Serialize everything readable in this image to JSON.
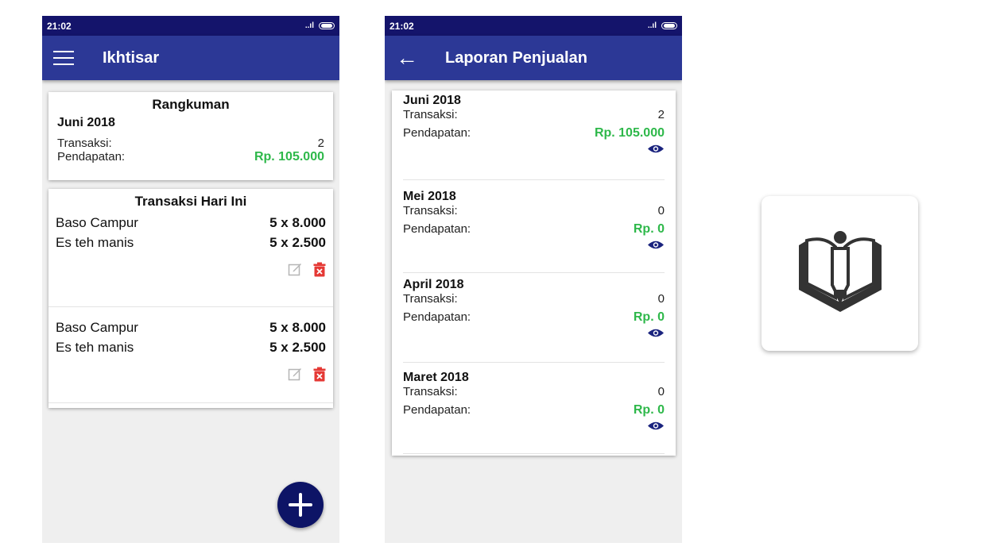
{
  "colors": {
    "statusbar": "#14146b",
    "appbar": "#2c3896",
    "fab": "#0d1466",
    "income_green": "#2eb84a",
    "delete_red": "#e53935",
    "eye_blue": "#1a237e"
  },
  "screen1": {
    "status_time": "21:02",
    "title": "Ikhtisar",
    "summary": {
      "title": "Rangkuman",
      "month": "Juni 2018",
      "transactions_label": "Transaksi:",
      "transactions_value": "2",
      "income_label": "Pendapatan:",
      "income_value": "Rp. 105.000"
    },
    "today": {
      "title": "Transaksi Hari Ini",
      "transactions": [
        {
          "items": [
            {
              "name": "Baso Campur",
              "qty": "5 x 8.000"
            },
            {
              "name": "Es teh manis",
              "qty": "5 x 2.500"
            }
          ]
        },
        {
          "items": [
            {
              "name": "Baso Campur",
              "qty": "5 x 8.000"
            },
            {
              "name": "Es teh manis",
              "qty": "5 x 2.500"
            }
          ]
        }
      ]
    }
  },
  "screen2": {
    "status_time": "21:02",
    "title": "Laporan Penjualan",
    "reports": [
      {
        "month": "Juni 2018",
        "transactions_label": "Transaksi:",
        "transactions_value": "2",
        "income_label": "Pendapatan:",
        "income_value": "Rp. 105.000"
      },
      {
        "month": "Mei 2018",
        "transactions_label": "Transaksi:",
        "transactions_value": "0",
        "income_label": "Pendapatan:",
        "income_value": "Rp. 0"
      },
      {
        "month": "April 2018",
        "transactions_label": "Transaksi:",
        "transactions_value": "0",
        "income_label": "Pendapatan:",
        "income_value": "Rp. 0"
      },
      {
        "month": "Maret 2018",
        "transactions_label": "Transaksi:",
        "transactions_value": "0",
        "income_label": "Pendapatan:",
        "income_value": "Rp. 0"
      }
    ]
  },
  "icons": {
    "menu": "hamburger-icon",
    "back": "arrow-left-icon",
    "edit": "edit-icon",
    "delete": "trash-icon",
    "view": "eye-icon",
    "add": "plus-icon",
    "logo": "book-pencil-logo"
  }
}
